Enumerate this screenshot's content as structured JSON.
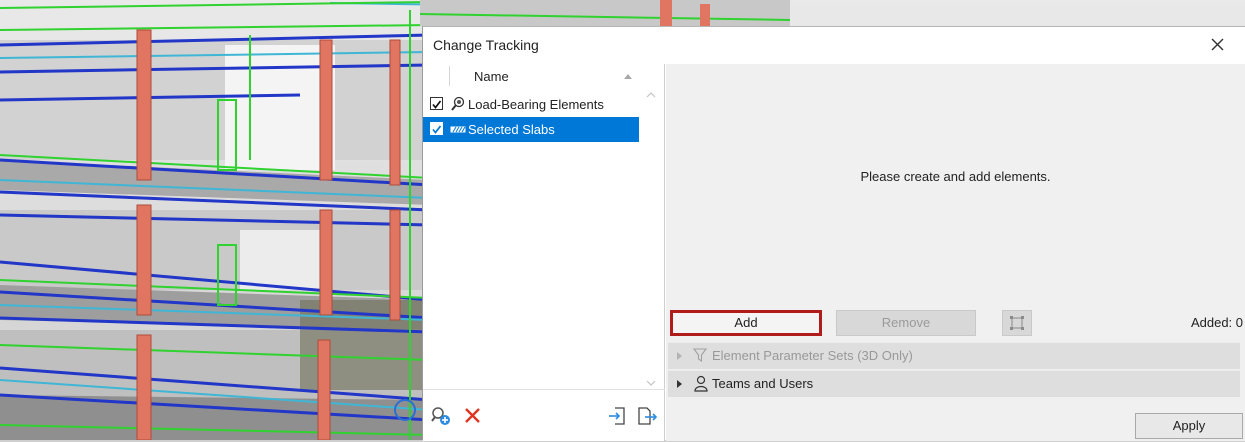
{
  "dialog": {
    "title": "Change Tracking",
    "close_icon": "close-icon"
  },
  "list": {
    "column_header": "Name",
    "items": [
      {
        "label": "Load-Bearing Elements",
        "checked": true,
        "icon": "magnifier-lens-icon",
        "selected": false
      },
      {
        "label": "Selected Slabs",
        "checked": true,
        "icon": "slab-hatch-icon",
        "selected": true
      }
    ],
    "bottom_actions": [
      "add-set-icon",
      "delete-icon",
      "import-icon",
      "export-icon"
    ]
  },
  "content": {
    "message": "Please create and add elements.",
    "add_label": "Add",
    "remove_label": "Remove",
    "added_label": "Added: 0",
    "sections": [
      {
        "label": "Element Parameter Sets (3D Only)",
        "enabled": false,
        "icon": "filter-icon"
      },
      {
        "label": "Teams and Users",
        "enabled": true,
        "icon": "user-icon"
      }
    ],
    "apply_label": "Apply"
  },
  "colors": {
    "selection": "#0078d7",
    "highlight_border": "#b01b1b",
    "delete_red": "#e0341f"
  }
}
